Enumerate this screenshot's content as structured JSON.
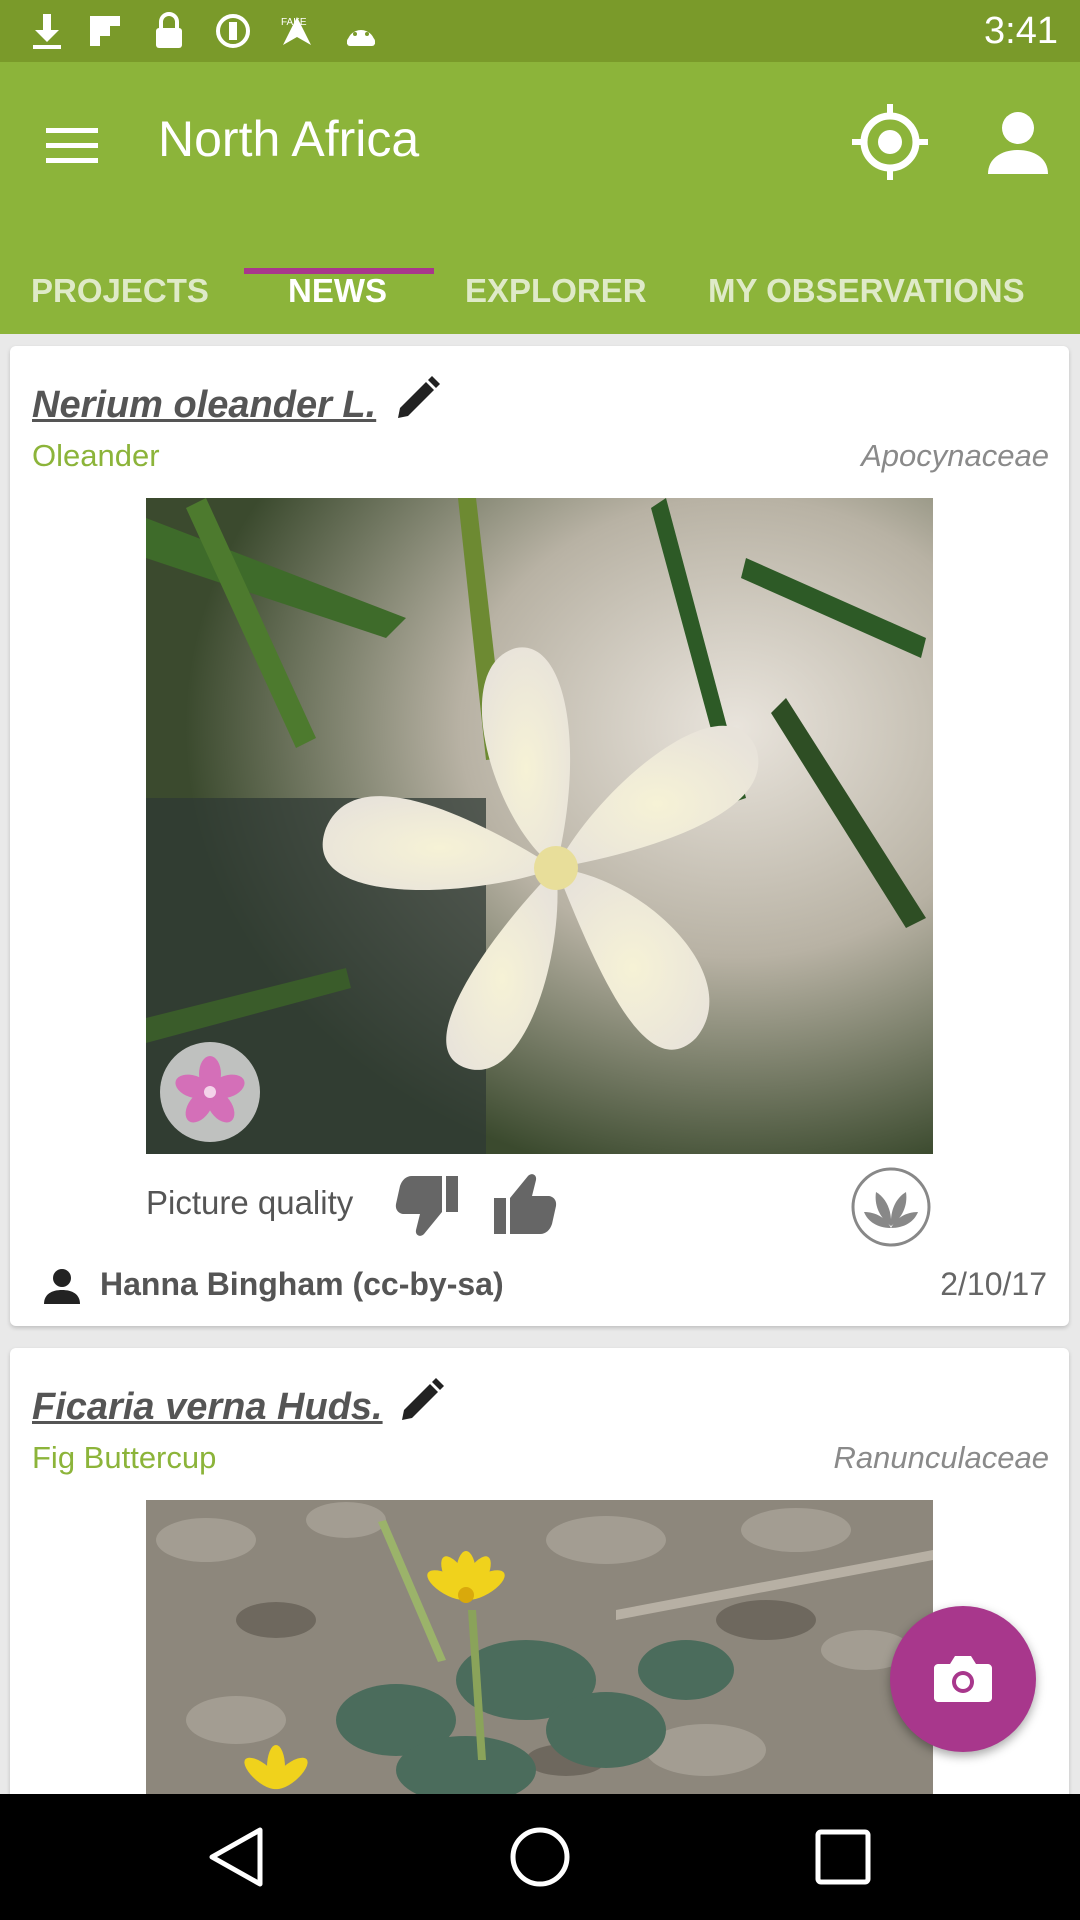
{
  "status_bar": {
    "time": "3:41",
    "icons": [
      "download-icon",
      "flipboard-icon",
      "lock-icon",
      "blocked-icon",
      "fake-gps-icon",
      "android-icon"
    ]
  },
  "app_bar": {
    "title": "North Africa",
    "menu_icon": "menu-icon",
    "location_icon": "gps-icon",
    "account_icon": "account-icon",
    "background_color": "#8cb43a"
  },
  "tabs": [
    {
      "label": "PROJECTS",
      "active": false
    },
    {
      "label": "NEWS",
      "active": true
    },
    {
      "label": "EXPLORER",
      "active": false
    },
    {
      "label": "MY OBSERVATIONS",
      "active": false
    }
  ],
  "accent_color": "#a8378c",
  "observations": [
    {
      "scientific_name": "Nerium oleander L.",
      "common_name": "Oleander",
      "family": "Apocynaceae",
      "picture_quality_label": "Picture quality",
      "author": "Hanna Bingham (cc-by-sa)",
      "date": "2/10/17"
    },
    {
      "scientific_name": "Ficaria verna Huds.",
      "common_name": "Fig Buttercup",
      "family": "Ranunculaceae"
    }
  ],
  "fab_icon": "camera-icon",
  "nav": [
    "back-icon",
    "home-icon",
    "recents-icon"
  ]
}
